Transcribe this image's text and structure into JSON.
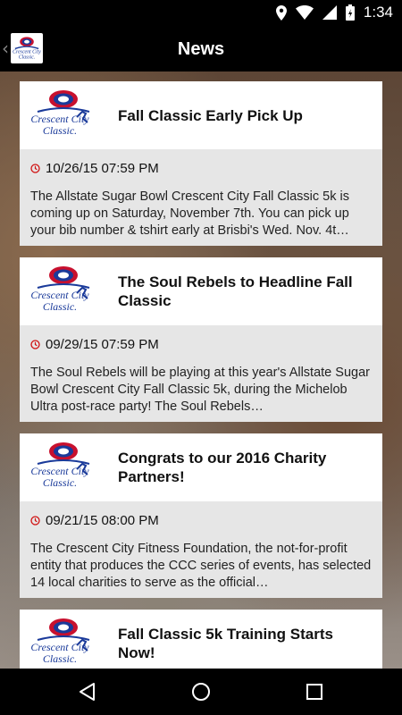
{
  "status_bar": {
    "time": "1:34",
    "icons": [
      "location-icon",
      "wifi-icon",
      "signal-icon",
      "battery-icon"
    ]
  },
  "app_bar": {
    "title": "News",
    "back_icon": "chevron-left-icon",
    "logo_icon": "crescent-city-classic-logo"
  },
  "colors": {
    "app_bar": "#000000",
    "card_header": "#ffffff",
    "card_body": "#e6e6e6",
    "clock_accent": "#d01010",
    "logo_blue": "#1a3a9a"
  },
  "news": [
    {
      "title": "Fall Classic Early Pick Up",
      "date": "10/26/15 07:59 PM",
      "summary": "The Allstate Sugar Bowl Crescent City Fall Classic 5k is coming up on Saturday, November 7th.  You can pick up your bib number & tshirt early  at  Brisbi's Wed. Nov. 4t…"
    },
    {
      "title": "The Soul Rebels to Headline Fall Classic",
      "date": "09/29/15 07:59 PM",
      "summary": "  The Soul Rebels will be playing at this year's Allstate Sugar Bowl Crescent City Fall Classic 5k, during the Michelob Ultra post-race party!   The Soul Rebels…"
    },
    {
      "title": "Congrats to our 2016 Charity Partners!",
      "date": "09/21/15 08:00 PM",
      "summary": "The Crescent City Fitness Foundation, the not-for-profit entity that produces the CCC series of events,  has selected 14 local charities to serve as the official…"
    },
    {
      "title": "Fall Classic 5k Training Starts Now!",
      "date": "",
      "summary": ""
    }
  ],
  "nav_bar": {
    "icons": [
      "back-triangle-icon",
      "home-circle-icon",
      "recents-square-icon"
    ]
  }
}
